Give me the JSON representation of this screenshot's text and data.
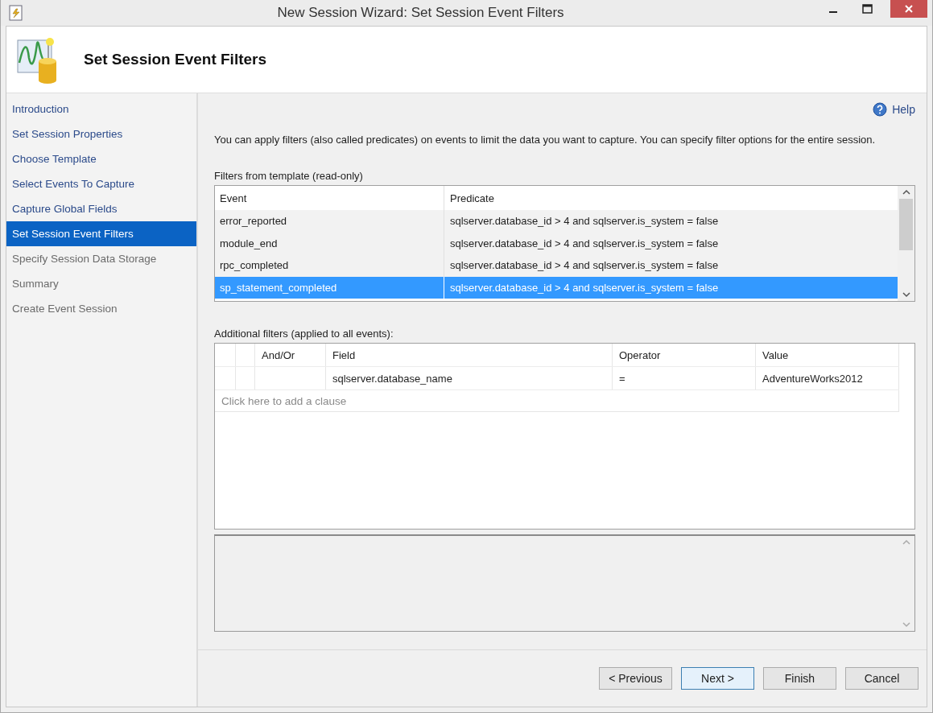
{
  "window": {
    "title": "New Session Wizard: Set Session Event Filters"
  },
  "header": {
    "title": "Set Session Event Filters"
  },
  "sidebar": {
    "items": [
      {
        "label": "Introduction",
        "selected": false,
        "disabled": false
      },
      {
        "label": "Set Session Properties",
        "selected": false,
        "disabled": false
      },
      {
        "label": "Choose Template",
        "selected": false,
        "disabled": false
      },
      {
        "label": "Select Events To Capture",
        "selected": false,
        "disabled": false
      },
      {
        "label": "Capture Global Fields",
        "selected": false,
        "disabled": false
      },
      {
        "label": "Set Session Event Filters",
        "selected": true,
        "disabled": false
      },
      {
        "label": "Specify Session Data Storage",
        "selected": false,
        "disabled": true
      },
      {
        "label": "Summary",
        "selected": false,
        "disabled": true
      },
      {
        "label": "Create Event Session",
        "selected": false,
        "disabled": true
      }
    ]
  },
  "help": {
    "label": "Help"
  },
  "description": "You can apply filters (also called predicates) on events to limit the data you want to capture. You can specify filter options for the entire session.",
  "template_filters": {
    "label": "Filters from template (read-only)",
    "columns": [
      "Event",
      "Predicate"
    ],
    "rows": [
      {
        "cells": [
          "error_reported",
          "sqlserver.database_id > 4 and sqlserver.is_system = false"
        ],
        "selected": false
      },
      {
        "cells": [
          "module_end",
          "sqlserver.database_id > 4 and sqlserver.is_system = false"
        ],
        "selected": false
      },
      {
        "cells": [
          "rpc_completed",
          "sqlserver.database_id > 4 and sqlserver.is_system = false"
        ],
        "selected": false
      },
      {
        "cells": [
          "sp_statement_completed",
          "sqlserver.database_id > 4 and sqlserver.is_system = false"
        ],
        "selected": true
      }
    ]
  },
  "additional_filters": {
    "label": "Additional filters (applied to all events):",
    "columns": [
      "And/Or",
      "Field",
      "Operator",
      "Value"
    ],
    "rows": [
      {
        "cells": [
          "",
          "sqlserver.database_name",
          "=",
          "AdventureWorks2012"
        ]
      }
    ],
    "add_clause": {
      "placeholder": "Click here to add a clause"
    }
  },
  "buttons": [
    {
      "label": "< Previous",
      "default": false
    },
    {
      "label": "Next >",
      "default": true
    },
    {
      "label": "Finish",
      "default": false
    },
    {
      "label": "Cancel",
      "default": false
    }
  ]
}
